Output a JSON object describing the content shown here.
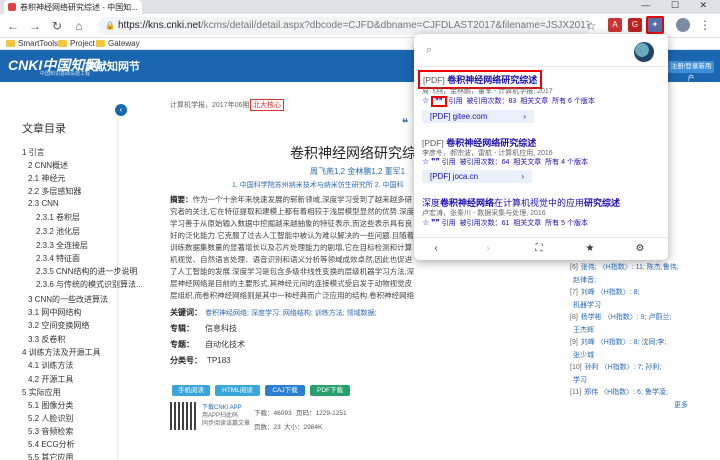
{
  "browser": {
    "tab_title": "卷积神经网络研究综述 - 中国知...",
    "url_main": "https://kns.cnki.net",
    "url_rest": "/kcms/detail/detail.aspx?dbcode=CJFD&dbname=CJFDLAST2017&filename=JSJX201706001&v=teU34i...",
    "window_controls": "— ☐ ✕",
    "bookmarks": [
      "SmartTools",
      "Project",
      "Gateway"
    ]
  },
  "cnki": {
    "logo": "CNKI中国知网",
    "logo_url": "www.cnki.net",
    "logo_sub": "中国知识基础设施工程",
    "header_title": "文献知网节",
    "register_label": "注册/登录新用户",
    "meta_line": "计算机学报，2017年06期",
    "core_badge": "北大核心",
    "article_title": "卷积神经网络研究综述",
    "authors": "周飞燕1,2    金林鹏1,2    董军1",
    "affiliations": "1. 中国科学院苏州纳米技术与纳米仿生研究所   2. 中国科",
    "abstract_label": "摘要：",
    "abstract": "作为一个十余年来快速发展的崭新领域,深度学习受到了越来越多研究者的关注,它在特征提取和建模上都有着相较于浅层模型显然的优势.深度学习善于从原始输入数据中挖掘越来越抽象的特征表示,而这些表示具有良好的泛化能力.它克服了过去人工智能中被认为难以解决的一些问题.且随着训练数据集数量的显著增长以及芯片处理能力的剧增,它在目标检测和计算机视觉、自然语言处理、语音识别和语义分析等领域成效卓然,因此也促进了人工智能的发展.深度学习是包含多级非线性变换的层级机器学习方法,深层神经网络是目前的主要形式,其神经元间的连接模式受启发于动物视觉皮层组织,而卷积神经网络则是其中一种经典而广泛应用的结构.卷积神经网络的局部连接、权值共享及池化操作等特性使之可以有效地降低网络的复杂度,减少训练参数的数目,使模型对平移、扭曲、缩放具有一定程度的不变性,并具有强鲁棒性和容错能力,且也易于训练和优化.基于这些优越的特性,它在各种信号和信息处理任务中的性能优于标准的全连接神经网络.本文首先概述了卷积神经网络的发展历史,然后分别描述了神经元模型、多层感知器的结构.接着,详细分析了卷积神经网络的结构,包括卷积层、池化层、全连接层...",
    "keywords_label": "关键词：",
    "keywords": "卷积神经网络;  深度学习;  网络结构;  训练方法;  领域数据;",
    "topic_label": "专辑：",
    "topic": "信息科技",
    "subject_label": "专题：",
    "subject": "自动化技术",
    "classno_label": "分类号：",
    "classno": "TP183",
    "dl_buttons": [
      "手机阅读",
      "HTML阅读",
      "CAJ下载",
      "PDF下载"
    ],
    "app_text": [
      "下载CNKI APP",
      "用APP扫此码",
      "同步阅读该篇文章"
    ],
    "stats": {
      "downloads_label": "下载：",
      "downloads": "46093",
      "pages_label": "页码：",
      "pages": "1229-1251",
      "pageno_label": "页数：",
      "pageno": "23",
      "size_label": "大小：",
      "size": "2984K"
    }
  },
  "toc": {
    "title": "文章目录",
    "items": [
      "1 引言",
      "2 CNN概述",
      "2.1 神经元",
      "2.2 多层感知器",
      "2.3 CNN",
      "2.3.1 卷积层",
      "2.3.2 池化层",
      "2.3.3 全连接层",
      "2.3.4 特征面",
      "2.3.5 CNN结构的进一步说明",
      "2.3.6 与传统的模式识别算法...",
      "3 CNN的一些改进算法",
      "3.1 网中网结构",
      "3.2 空间变换网络",
      "3.3 反卷积",
      "4 训练方法及开源工具",
      "4.1 训练方法",
      "4.2 开源工具",
      "5 实际应用",
      "5.1 图像分类",
      "5.2 人脸识别",
      "5.3 音频检索",
      "5.4 ECG分析",
      "5.5 其它应用"
    ]
  },
  "right_refs": [
    {
      "num": "[6]",
      "text": "张伟; 〈H指数〉: 11; 陈杰;鲁伟;"
    },
    {
      "num": "",
      "text": "赵律音;"
    },
    {
      "num": "[7]",
      "text": "刘峰 〈H指数〉: 8;"
    },
    {
      "num": "",
      "text": "机器学习"
    },
    {
      "num": "[8]",
      "text": "杨学彬 〈H指数〉: 9; 卢蔚兰;"
    },
    {
      "num": "",
      "text": "王杰辉"
    },
    {
      "num": "[9]",
      "text": "刘峰 〈H指数〉: 8; 沈同;李;"
    },
    {
      "num": "",
      "text": "张少城"
    },
    {
      "num": "[10]",
      "text": "孙利 〈H指数〉: 7; 孙利;"
    },
    {
      "num": "",
      "text": "学习"
    },
    {
      "num": "[11]",
      "text": "郑伟 〈H指数〉: 6; 鲁学凌;"
    }
  ],
  "right_more": "更多",
  "popup": {
    "results": [
      {
        "type_tag": "[PDF]",
        "title": "卷积神经网络研究综述",
        "meta": "周飞燕，金林鹏，董军 - 计算机学报, 2017",
        "cite_label": "引用",
        "cited_by": "被引用次数：83",
        "related": "相关文章",
        "versions": "所有 6 个版本",
        "link": "[PDF] gitee.com"
      },
      {
        "type_tag": "[PDF]",
        "title": "卷积神经网络研究综述",
        "meta": "李彦冬，郝宗波，雷航 - 计算机应用, 2016",
        "cite_label": "引用",
        "cited_by": "被引用次数：64",
        "related": "相关文章",
        "versions": "所有 4 个版本",
        "link": "[PDF] joca.cn"
      },
      {
        "type_tag": "",
        "title_parts": [
          "深度",
          "卷积神经网络",
          "在计算机视觉中的应用",
          "研究综述"
        ],
        "meta": "卢宏涛，张秦川 - 数据采集与处理, 2016",
        "cite_label": "引用",
        "cited_by": "被引用次数：61",
        "related": "相关文章",
        "versions": "所有 5 个版本"
      }
    ],
    "footer_icons": [
      "chevron-left-icon",
      "chevron-right-icon",
      "fullscreen-icon",
      "star-icon",
      "settings-icon"
    ]
  },
  "colors": {
    "cnki_blue": "#1b66b1",
    "scholar_link": "#1a0dab",
    "highlight_red": "#e00000"
  }
}
